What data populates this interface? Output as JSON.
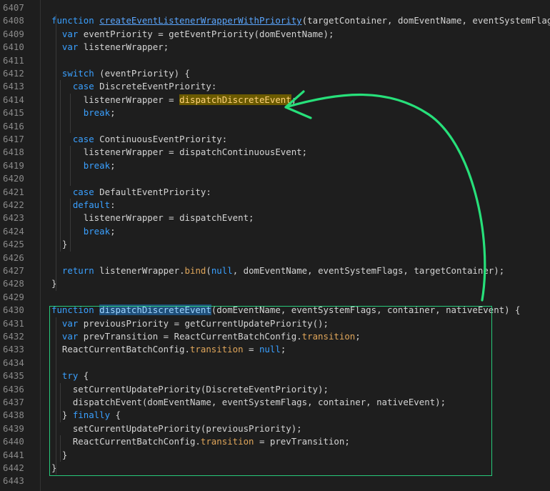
{
  "lines": [
    {
      "n": "6407",
      "code": ""
    },
    {
      "n": "6408",
      "code": "function createEventListenerWrapperWithPriority(targetContainer, domEventName, eventSystemFlags) {"
    },
    {
      "n": "6409",
      "code": "  var eventPriority = getEventPriority(domEventName);"
    },
    {
      "n": "6410",
      "code": "  var listenerWrapper;"
    },
    {
      "n": "6411",
      "code": ""
    },
    {
      "n": "6412",
      "code": "  switch (eventPriority) {"
    },
    {
      "n": "6413",
      "code": "    case DiscreteEventPriority:"
    },
    {
      "n": "6414",
      "code": "      listenerWrapper = dispatchDiscreteEvent;"
    },
    {
      "n": "6415",
      "code": "      break;"
    },
    {
      "n": "6416",
      "code": ""
    },
    {
      "n": "6417",
      "code": "    case ContinuousEventPriority:"
    },
    {
      "n": "6418",
      "code": "      listenerWrapper = dispatchContinuousEvent;"
    },
    {
      "n": "6419",
      "code": "      break;"
    },
    {
      "n": "6420",
      "code": ""
    },
    {
      "n": "6421",
      "code": "    case DefaultEventPriority:"
    },
    {
      "n": "6422",
      "code": "    default:"
    },
    {
      "n": "6423",
      "code": "      listenerWrapper = dispatchEvent;"
    },
    {
      "n": "6424",
      "code": "      break;"
    },
    {
      "n": "6425",
      "code": "  }"
    },
    {
      "n": "6426",
      "code": ""
    },
    {
      "n": "6427",
      "code": "  return listenerWrapper.bind(null, domEventName, eventSystemFlags, targetContainer);"
    },
    {
      "n": "6428",
      "code": "}"
    },
    {
      "n": "6429",
      "code": ""
    },
    {
      "n": "6430",
      "code": "function dispatchDiscreteEvent(domEventName, eventSystemFlags, container, nativeEvent) {"
    },
    {
      "n": "6431",
      "code": "  var previousPriority = getCurrentUpdatePriority();"
    },
    {
      "n": "6432",
      "code": "  var prevTransition = ReactCurrentBatchConfig.transition;"
    },
    {
      "n": "6433",
      "code": "  ReactCurrentBatchConfig.transition = null;"
    },
    {
      "n": "6434",
      "code": ""
    },
    {
      "n": "6435",
      "code": "  try {"
    },
    {
      "n": "6436",
      "code": "    setCurrentUpdatePriority(DiscreteEventPriority);"
    },
    {
      "n": "6437",
      "code": "    dispatchEvent(domEventName, eventSystemFlags, container, nativeEvent);"
    },
    {
      "n": "6438",
      "code": "  } finally {"
    },
    {
      "n": "6439",
      "code": "    setCurrentUpdatePriority(previousPriority);"
    },
    {
      "n": "6440",
      "code": "    ReactCurrentBatchConfig.transition = prevTransition;"
    },
    {
      "n": "6441",
      "code": "  }"
    },
    {
      "n": "6442",
      "code": "}"
    },
    {
      "n": "6443",
      "code": ""
    }
  ],
  "colors": {
    "keyword": "#3aa0ff",
    "function_name": "#5aa6ff",
    "property": "#e0a65a",
    "highlight_orange": "#6b5a00",
    "highlight_blue": "#1f4f7a",
    "annotation_green": "#27e07a",
    "background": "#1e1e1e"
  },
  "annotation": {
    "box_around": "dispatchDiscreteEvent definition",
    "arrow_to": "dispatchDiscreteEvent reference"
  }
}
